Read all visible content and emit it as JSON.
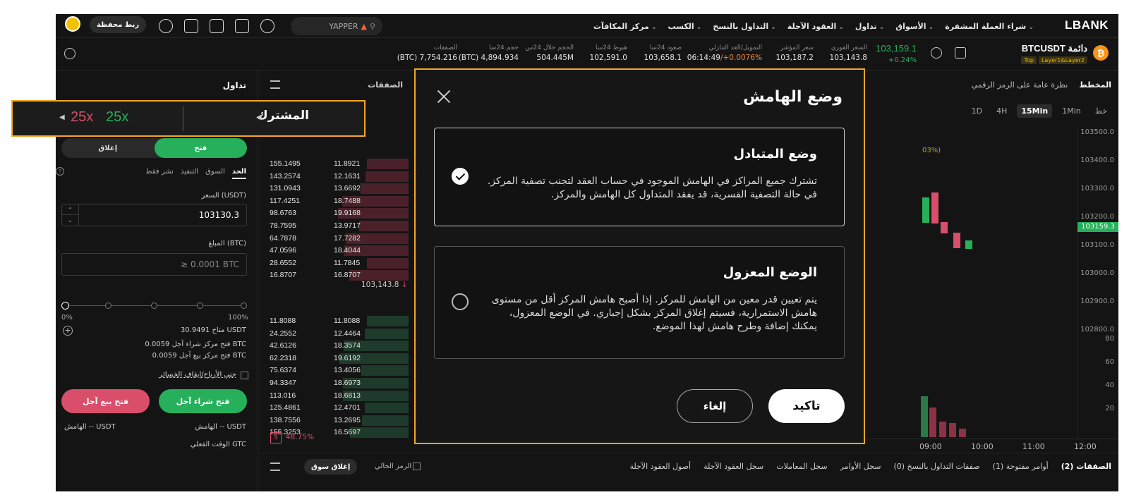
{
  "topnav": {
    "logo": "LBANK",
    "menu": [
      "شراء العملة المشفرة",
      "الأسواق",
      "تداول",
      "العقود الآجلة",
      "التداول بالنسخ",
      "الكسب",
      "مركز المكافآت"
    ],
    "search_value": "YAPPER",
    "wallet_button": "ربط محفظة",
    "icons": [
      "download-icon",
      "wallet-icon",
      "bell-icon",
      "document-icon",
      "globe-icon"
    ]
  },
  "ticker": {
    "symbol": "BTCUSDT دائمة",
    "coin_glyph": "₿",
    "tags": [
      "Layer1&Layer2",
      "Top"
    ],
    "price": "103,159.1",
    "change": "+0.24%",
    "stats": [
      {
        "label": "السعر الفوري",
        "value": "103,143.8"
      },
      {
        "label": "سعر المؤشر",
        "value": "103,187.2"
      },
      {
        "label": "التمويل/العد التنازلي",
        "value_time": "06:14:49",
        "value_rate": "/+0.0076%"
      },
      {
        "label": "صعود 24سا",
        "value": "103,658.1"
      },
      {
        "label": "هبوط 24سا",
        "value": "102,591.0"
      },
      {
        "label": "الحجم خلال 24س",
        "value": "504.445M"
      },
      {
        "label": "حجم 24سا",
        "value": "(BTC) 4,894.934"
      },
      {
        "label": "الصفقات",
        "value": "(BTC) 7,754.216"
      }
    ]
  },
  "trade_panel": {
    "title": "تداول",
    "margin_mode": "المشترك",
    "leverage_long": "25x",
    "leverage_short": "25x",
    "open_label": "فتح",
    "close_label": "إغلاق",
    "order_types": [
      "الحد",
      "السوق",
      "التنفيذ",
      "نشر فقط"
    ],
    "price_label": "السعر (USDT)",
    "price_value": "103130.3",
    "amount_label": "المبلغ (BTC)",
    "amount_placeholder": "≥ 0.0001 BTC",
    "pct_min": "0%",
    "pct_max": "100%",
    "available": "متاح  30.9491 USDT",
    "open_long_qty": "فتح مركز شراء آجل  0.0059 BTC",
    "open_short_qty": "فتح مركز بيع آجل  0.0059 BTC",
    "tpsl_label": "جني الأرباح/إيقاف الخسائر",
    "buy_button": "فتح شراء آجل",
    "sell_button": "فتح بيع آجل",
    "margin_long": "الهامش  -- USDT",
    "margin_short": "الهامش  -- USDT",
    "time_in_force": "الوقت الفعلي  GTC"
  },
  "orderbook": {
    "title": "الصفقات",
    "asks": [
      [
        "155.1495",
        "11.8921"
      ],
      [
        "143.2574",
        "12.1631"
      ],
      [
        "131.0943",
        "13.6692"
      ],
      [
        "117.4251",
        "18.7488"
      ],
      [
        "98.6763",
        "19.9168"
      ],
      [
        "78.7595",
        "13.9717"
      ],
      [
        "64.7878",
        "17.7282"
      ],
      [
        "47.0596",
        "18.4044"
      ],
      [
        "28.6552",
        "11.7845"
      ],
      [
        "16.8707",
        "16.8707"
      ]
    ],
    "mid_price": "103,143.8",
    "bids": [
      [
        "11.8088",
        "11.8088"
      ],
      [
        "24.2552",
        "12.4464"
      ],
      [
        "42.6126",
        "18.3574"
      ],
      [
        "62.2318",
        "19.6192"
      ],
      [
        "75.6374",
        "13.4056"
      ],
      [
        "94.3347",
        "18.6973"
      ],
      [
        "113.016",
        "18.6813"
      ],
      [
        "125.4861",
        "12.4701"
      ],
      [
        "138.7556",
        "13.2695"
      ],
      [
        "155.3253",
        "16.5697"
      ]
    ],
    "sell_ratio": "48.75%",
    "sell_glyph": "S"
  },
  "chart": {
    "tabs": [
      "المخطط",
      "نظرة عامة على الرمز الرقمي"
    ],
    "intervals": [
      "خط",
      "1Min",
      "15Min",
      "4H",
      "1D"
    ],
    "active_interval": "15Min",
    "partial_label": "03%)",
    "y_labels": [
      "103500.0",
      "103400.0",
      "103300.0",
      "103200.0",
      "103100.0",
      "103000.0",
      "102900.0",
      "102800.0"
    ],
    "current_price_tag": "103159.3",
    "volume_labels": [
      "80",
      "60",
      "40",
      "20"
    ],
    "x_labels": [
      "09:00",
      "10:00",
      "11:00",
      "12:00"
    ]
  },
  "bottom": {
    "tabs": [
      "الصفقات (2)",
      "أوامر مفتوحة (1)",
      "صفقات التداول بالنسخ (0)",
      "سجل الأوامر",
      "سجل المعاملات",
      "سجل العقود الآجلة",
      "أصول العقود الآجلة"
    ],
    "current_symbol_only": "الرمز الحالي",
    "market_close": "إغلاق سوق"
  },
  "modal": {
    "title": "وضع الهامش",
    "options": [
      {
        "title": "وضع المتبادل",
        "desc": "تشترك جميع المراكز في الهامش الموجود في حساب العقد لتجنب تصفية المركز. في حالة التصفية القسرية، قد يفقد المتداول كل الهامش والمركز.",
        "selected": true
      },
      {
        "title": "الوضع المعزول",
        "desc": "يتم تعيين قدر معين من الهامش للمركز. إذا أصبح هامش المركز أقل من مستوى هامش الاستمرارية، فسيتم إغلاق المركز بشكل إجباري. في الوضع المعزول، يمكنك إضافة وطرح هامش لهذا الموضع.",
        "selected": false
      }
    ],
    "confirm": "تاكيد",
    "cancel": "إلغاء"
  },
  "colors": {
    "up": "#27b05b",
    "down": "#d94e6b",
    "highlight": "#f5a623"
  }
}
